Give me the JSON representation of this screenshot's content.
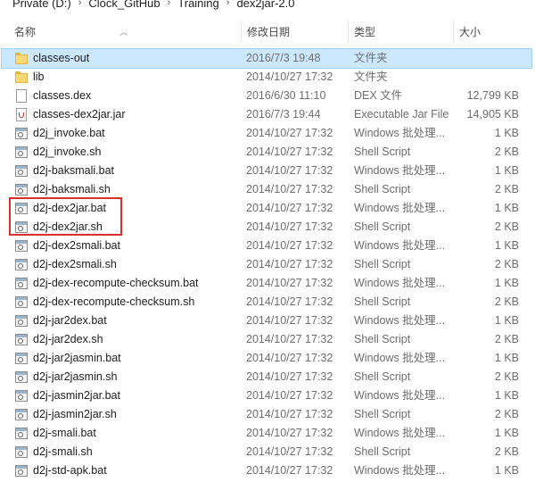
{
  "breadcrumb": [
    "Private (D:)",
    "Clock_GitHub",
    "Training",
    "dex2jar-2.0"
  ],
  "columns": {
    "name": "名称",
    "date": "修改日期",
    "type": "类型",
    "size": "大小"
  },
  "files": [
    {
      "name": "classes-out",
      "date": "2016/7/3 19:48",
      "type": "文件夹",
      "size": "",
      "icon": "folder",
      "selected": true
    },
    {
      "name": "lib",
      "date": "2014/10/27 17:32",
      "type": "文件夹",
      "size": "",
      "icon": "folder"
    },
    {
      "name": "classes.dex",
      "date": "2016/6/30 11:10",
      "type": "DEX 文件",
      "size": "12,799 KB",
      "icon": "file"
    },
    {
      "name": "classes-dex2jar.jar",
      "date": "2016/7/3 19:44",
      "type": "Executable Jar File",
      "size": "14,905 KB",
      "icon": "jar"
    },
    {
      "name": "d2j_invoke.bat",
      "date": "2014/10/27 17:32",
      "type": "Windows 批处理...",
      "size": "1 KB",
      "icon": "script"
    },
    {
      "name": "d2j_invoke.sh",
      "date": "2014/10/27 17:32",
      "type": "Shell Script",
      "size": "2 KB",
      "icon": "script"
    },
    {
      "name": "d2j-baksmali.bat",
      "date": "2014/10/27 17:32",
      "type": "Windows 批处理...",
      "size": "1 KB",
      "icon": "script"
    },
    {
      "name": "d2j-baksmali.sh",
      "date": "2014/10/27 17:32",
      "type": "Shell Script",
      "size": "2 KB",
      "icon": "script"
    },
    {
      "name": "d2j-dex2jar.bat",
      "date": "2014/10/27 17:32",
      "type": "Windows 批处理...",
      "size": "1 KB",
      "icon": "script"
    },
    {
      "name": "d2j-dex2jar.sh",
      "date": "2014/10/27 17:32",
      "type": "Shell Script",
      "size": "2 KB",
      "icon": "script"
    },
    {
      "name": "d2j-dex2smali.bat",
      "date": "2014/10/27 17:32",
      "type": "Windows 批处理...",
      "size": "1 KB",
      "icon": "script"
    },
    {
      "name": "d2j-dex2smali.sh",
      "date": "2014/10/27 17:32",
      "type": "Shell Script",
      "size": "2 KB",
      "icon": "script"
    },
    {
      "name": "d2j-dex-recompute-checksum.bat",
      "date": "2014/10/27 17:32",
      "type": "Windows 批处理...",
      "size": "1 KB",
      "icon": "script"
    },
    {
      "name": "d2j-dex-recompute-checksum.sh",
      "date": "2014/10/27 17:32",
      "type": "Shell Script",
      "size": "2 KB",
      "icon": "script"
    },
    {
      "name": "d2j-jar2dex.bat",
      "date": "2014/10/27 17:32",
      "type": "Windows 批处理...",
      "size": "1 KB",
      "icon": "script"
    },
    {
      "name": "d2j-jar2dex.sh",
      "date": "2014/10/27 17:32",
      "type": "Shell Script",
      "size": "2 KB",
      "icon": "script"
    },
    {
      "name": "d2j-jar2jasmin.bat",
      "date": "2014/10/27 17:32",
      "type": "Windows 批处理...",
      "size": "1 KB",
      "icon": "script"
    },
    {
      "name": "d2j-jar2jasmin.sh",
      "date": "2014/10/27 17:32",
      "type": "Shell Script",
      "size": "2 KB",
      "icon": "script"
    },
    {
      "name": "d2j-jasmin2jar.bat",
      "date": "2014/10/27 17:32",
      "type": "Windows 批处理...",
      "size": "1 KB",
      "icon": "script"
    },
    {
      "name": "d2j-jasmin2jar.sh",
      "date": "2014/10/27 17:32",
      "type": "Shell Script",
      "size": "2 KB",
      "icon": "script"
    },
    {
      "name": "d2j-smali.bat",
      "date": "2014/10/27 17:32",
      "type": "Windows 批处理...",
      "size": "1 KB",
      "icon": "script"
    },
    {
      "name": "d2j-smali.sh",
      "date": "2014/10/27 17:32",
      "type": "Shell Script",
      "size": "2 KB",
      "icon": "script"
    },
    {
      "name": "d2j-std-apk.bat",
      "date": "2014/10/27 17:32",
      "type": "Windows 批处理...",
      "size": "1 KB",
      "icon": "script"
    }
  ],
  "colors": {
    "selection": "#cce8ff",
    "highlight_border": "#d9302c",
    "folder": "#f8d775"
  }
}
